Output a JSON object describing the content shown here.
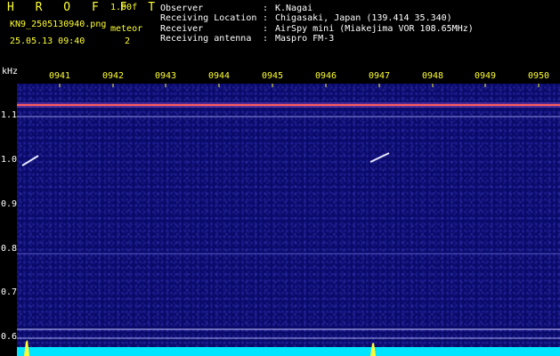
{
  "header": {
    "app_title": "H R O F F T",
    "version": "1.00f",
    "filename": "KN9_2505130940.png",
    "datetime": "25.05.13 09:40",
    "meteor_label": "meteor",
    "meteor_count": "2"
  },
  "meta": [
    {
      "label": "Observer",
      "value": "K.Nagai"
    },
    {
      "label": "Receiving Location",
      "value": "Chigasaki, Japan (139.414 35.340)"
    },
    {
      "label": "Receiver",
      "value": "AirSpy mini (Miakejima VOR 108.65MHz)"
    },
    {
      "label": "Receiving antenna",
      "value": "Maspro FM-3"
    }
  ],
  "axis": {
    "y_unit": "kHz",
    "y_ticks": [
      "1.1",
      "1.0",
      "0.9",
      "0.8",
      "0.7",
      "0.6"
    ],
    "x_ticks": [
      "0941",
      "0942",
      "0943",
      "0944",
      "0945",
      "0946",
      "0947",
      "0948",
      "0949",
      "0950"
    ]
  },
  "colors": {
    "accent": "#ffff33",
    "background": "#0a0a6a",
    "carrier": "#ff5a5a",
    "baseline": "#00e5ff"
  }
}
